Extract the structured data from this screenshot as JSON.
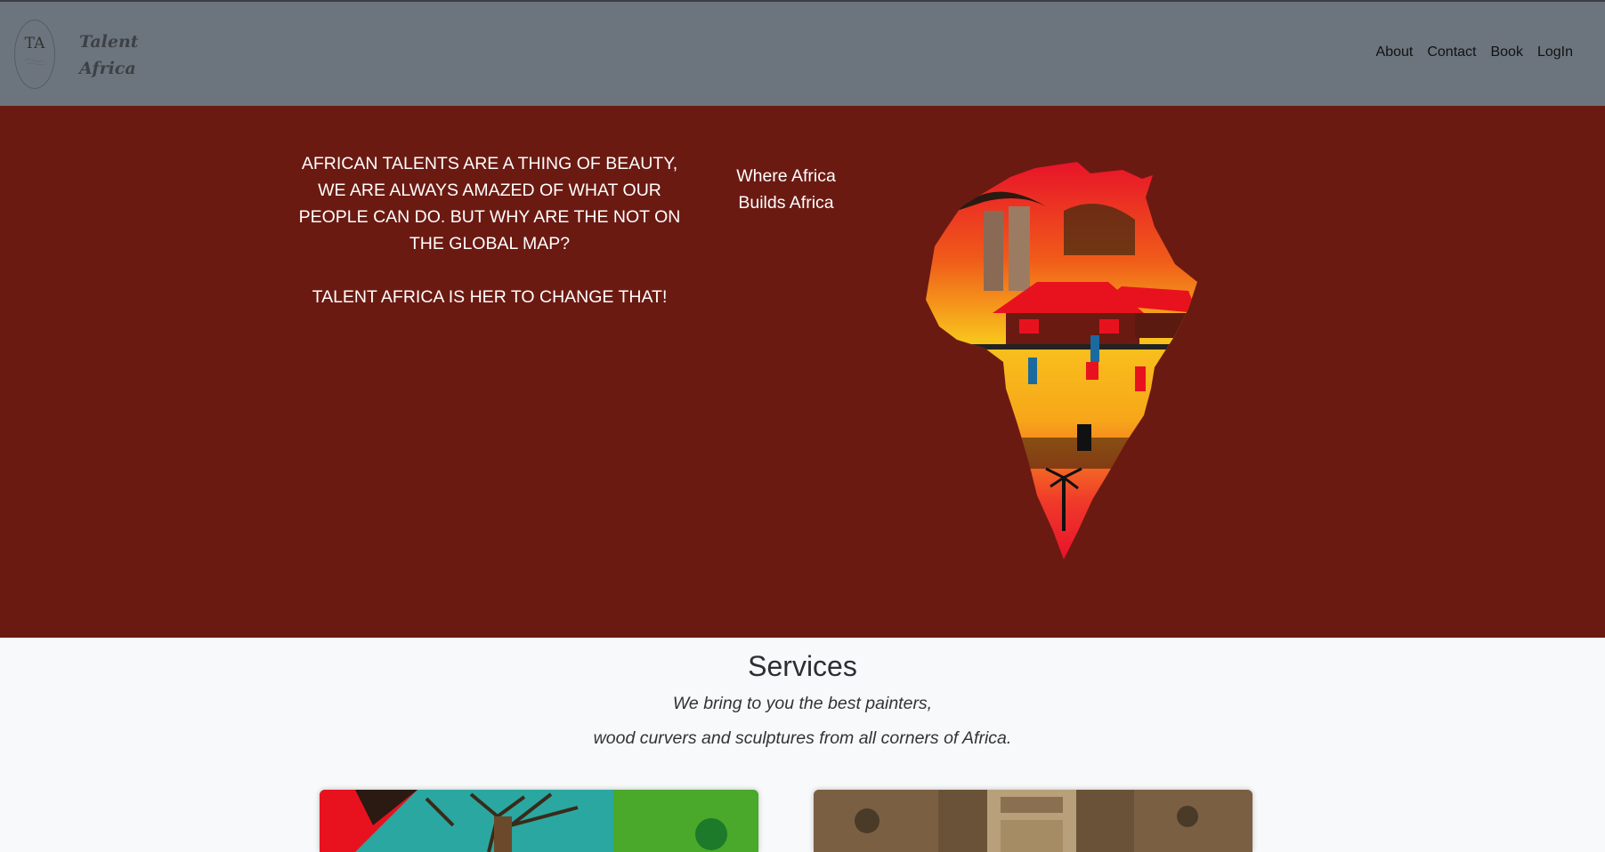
{
  "header": {
    "logo_initials": "TA",
    "brand_line1": "Talent",
    "brand_line2": "Africa",
    "nav": [
      {
        "label": "About"
      },
      {
        "label": "Contact"
      },
      {
        "label": "Book"
      },
      {
        "label": "LogIn"
      }
    ]
  },
  "hero": {
    "paragraph1": "AFRICAN TALENTS ARE A THING OF BEAUTY, WE ARE ALWAYS AMAZED OF WHAT OUR PEOPLE CAN DO. BUT WHY ARE THE NOT ON THE GLOBAL MAP?",
    "paragraph2": "TALENT AFRICA IS HER TO CHANGE THAT!",
    "tagline": "Where Africa Builds Africa"
  },
  "services": {
    "title": "Services",
    "subtitle_line1": "We bring to you the best painters,",
    "subtitle_line2": "wood curvers and sculptures from all corners of Africa."
  },
  "colors": {
    "navbar": "#6c757d",
    "hero_bg": "#6b1a12",
    "page_bg": "#f8f9fa"
  }
}
